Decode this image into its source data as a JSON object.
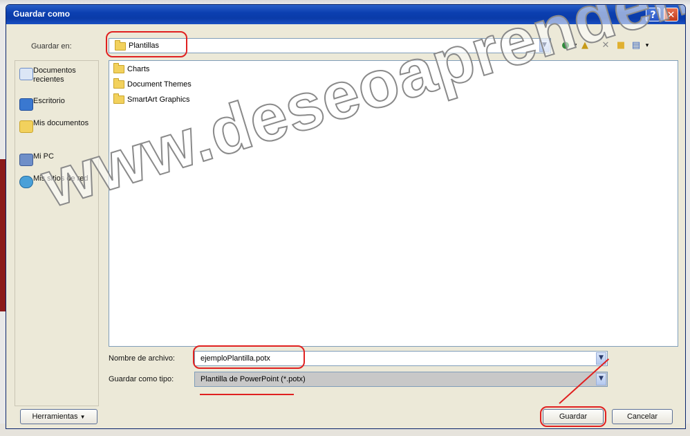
{
  "window": {
    "title": "Guardar como",
    "help_glyph": "?",
    "close_glyph": "✕"
  },
  "save_in": {
    "label": "Guardar en:",
    "value": "Plantillas"
  },
  "toolbar_icons": [
    "back-icon",
    "up-folder-icon",
    "delete-icon",
    "new-folder-icon",
    "views-icon"
  ],
  "places": [
    {
      "label": "Documentos recientes",
      "icon": "recent-documents-icon"
    },
    {
      "label": "Escritorio",
      "icon": "desktop-icon"
    },
    {
      "label": "Mis documentos",
      "icon": "my-documents-icon"
    },
    {
      "label": "Mi PC",
      "icon": "my-computer-icon"
    },
    {
      "label": "Mis sitios de red",
      "icon": "network-places-icon"
    }
  ],
  "files": [
    {
      "name": "Charts"
    },
    {
      "name": "Document Themes"
    },
    {
      "name": "SmartArt Graphics"
    }
  ],
  "filename": {
    "label": "Nombre de archivo:",
    "value": "ejemploPlantilla.potx"
  },
  "filetype": {
    "label": "Guardar como tipo:",
    "value": "Plantilla de PowerPoint (*.potx)"
  },
  "buttons": {
    "tools": "Herramientas",
    "save": "Guardar",
    "cancel": "Cancelar"
  },
  "watermark": "www.deseoaprender.com",
  "colors": {
    "titlebar": "#0b3fb0",
    "annotation": "#e02020",
    "dialog_bg": "#ece9d8"
  }
}
